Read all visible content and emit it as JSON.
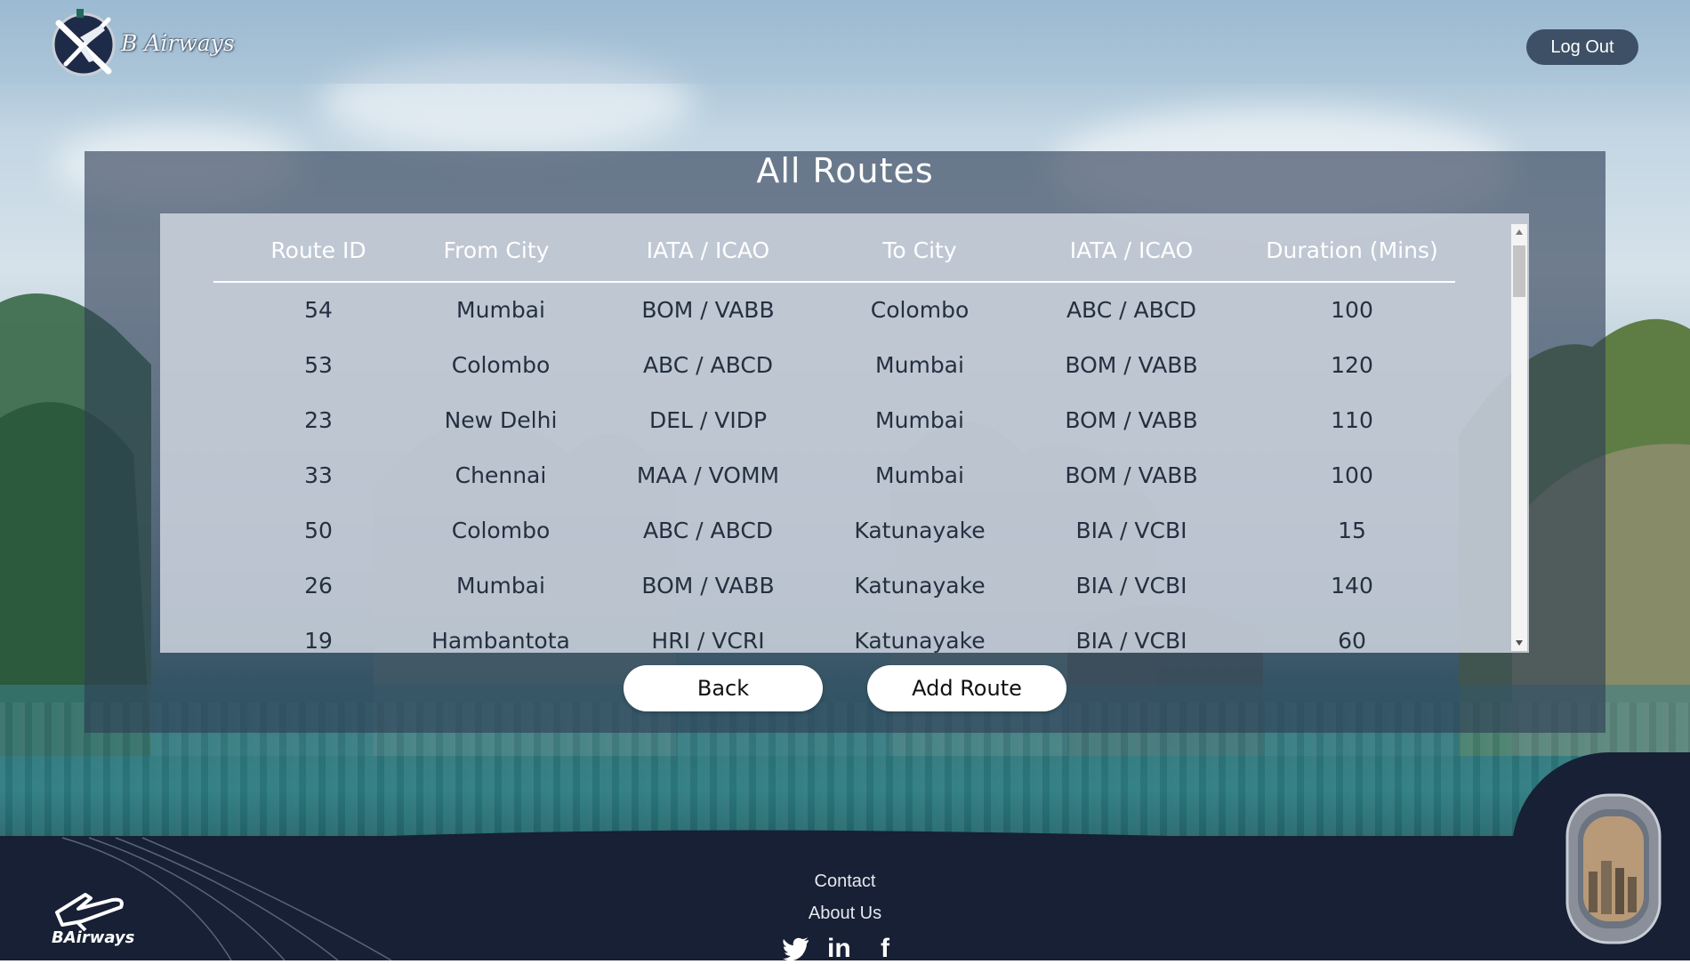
{
  "header": {
    "brand": "B Airways",
    "logout_label": "Log Out"
  },
  "page": {
    "title": "All Routes"
  },
  "table": {
    "columns": [
      "Route ID",
      "From City",
      "IATA / ICAO",
      "To City",
      "IATA / ICAO",
      "Duration (Mins)"
    ],
    "rows": [
      [
        "54",
        "Mumbai",
        "BOM / VABB",
        "Colombo",
        "ABC / ABCD",
        "100"
      ],
      [
        "53",
        "Colombo",
        "ABC / ABCD",
        "Mumbai",
        "BOM / VABB",
        "120"
      ],
      [
        "23",
        "New Delhi",
        "DEL / VIDP",
        "Mumbai",
        "BOM / VABB",
        "110"
      ],
      [
        "33",
        "Chennai",
        "MAA / VOMM",
        "Mumbai",
        "BOM / VABB",
        "100"
      ],
      [
        "50",
        "Colombo",
        "ABC / ABCD",
        "Katunayake",
        "BIA / VCBI",
        "15"
      ],
      [
        "26",
        "Mumbai",
        "BOM / VABB",
        "Katunayake",
        "BIA / VCBI",
        "140"
      ],
      [
        "19",
        "Hambantota",
        "HRI / VCRI",
        "Katunayake",
        "BIA / VCBI",
        "60"
      ]
    ]
  },
  "actions": {
    "back_label": "Back",
    "add_route_label": "Add Route"
  },
  "footer": {
    "contact_label": "Contact",
    "about_label": "About Us",
    "footer_brand": "BAirways",
    "social": [
      {
        "icon": "twitter-icon",
        "glyph": "🐦"
      },
      {
        "icon": "linkedin-icon",
        "glyph": "in"
      },
      {
        "icon": "facebook-icon",
        "glyph": "f"
      }
    ]
  },
  "colors": {
    "header_button": "#3d5066",
    "panel": "#2e3e56",
    "footer": "#172034"
  }
}
